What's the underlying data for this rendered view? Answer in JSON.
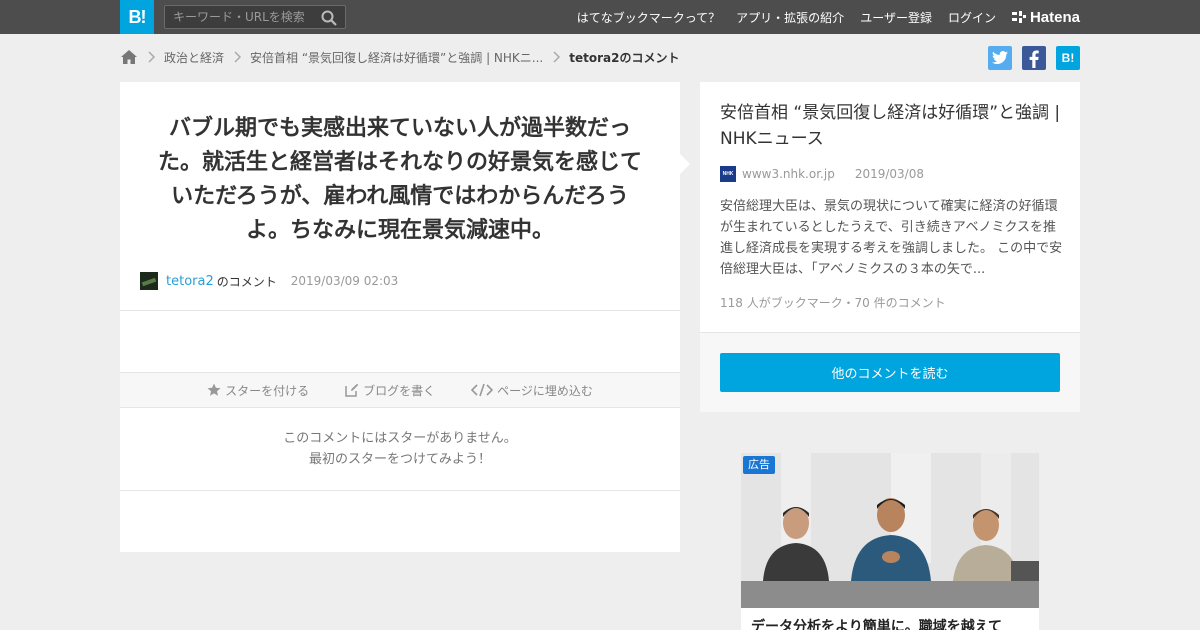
{
  "header": {
    "logo": "B!",
    "search_placeholder": "キーワード・URLを検索",
    "nav": [
      "はてなブックマークって？",
      "アプリ・拡張の紹介",
      "ユーザー登録",
      "ログイン"
    ],
    "brand": "Hatena"
  },
  "breadcrumb": {
    "category": "政治と経済",
    "entry": "安倍首相 “景気回復し経済は好循環”と強調 | NHKニ...",
    "current": "tetora2のコメント"
  },
  "share": {
    "hatena": "B!"
  },
  "comment": {
    "text": "バブル期でも実感出来ていない人が過半数だった。就活生と経営者はそれなりの好景気を感じていただろうが、雇われ風情ではわからんだろうよ。ちなみに現在景気減速中。",
    "username": "tetora2",
    "suffix": "のコメント",
    "date": "2019/03/09 02:03",
    "actions": {
      "star": "スターを付ける",
      "blog": "ブログを書く",
      "embed": "ページに埋め込む"
    },
    "no_stars_line1": "このコメントにはスターがありません。",
    "no_stars_line2": "最初のスターをつけてみよう！"
  },
  "entry": {
    "title": "安倍首相 “景気回復し経済は好循環”と強調 | NHKニュース",
    "favicon_text": "NHK",
    "domain": "www3.nhk.or.jp",
    "date": "2019/03/08",
    "summary": "安倍総理大臣は、景気の現状について確実に経済の好循環が生まれているとしたうえで、引き続きアベノミクスを推進し経済成長を実現する考えを強調しました。 この中で安倍総理大臣は、「アベノミクスの３本の矢で...",
    "counts": "118 人がブックマーク・70 件のコメント",
    "read_more": "他のコメントを読む"
  },
  "ad": {
    "badge": "広告",
    "caption": "データ分析をより簡単に。職域を越えて"
  },
  "colors": {
    "header_bg": "#4d4d4d",
    "brand_blue": "#00a4de",
    "link": "#2a9fd6",
    "twitter": "#55acee",
    "facebook": "#3b5998"
  }
}
